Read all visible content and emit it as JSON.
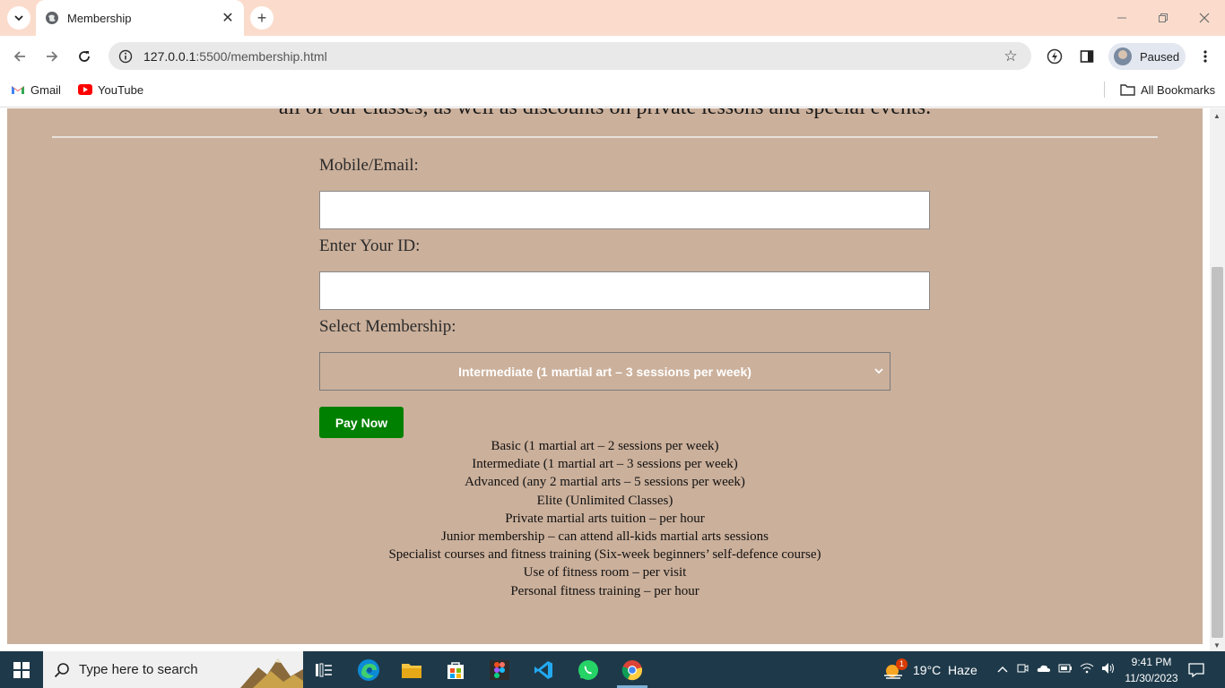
{
  "browser": {
    "tab_title": "Membership",
    "url_host": "127.0.0.1",
    "url_rest": ":5500/membership.html",
    "profile_label": "Paused",
    "bookmarks": [
      "Gmail",
      "YouTube"
    ],
    "all_bookmarks": "All Bookmarks"
  },
  "page": {
    "cut_heading": "all of our classes, as well as discounts on private lessons and special events.",
    "form": {
      "mobile_label": "Mobile/Email:",
      "mobile_value": "",
      "id_label": "Enter Your ID:",
      "id_value": "",
      "membership_label": "Select Membership:",
      "membership_selected": "Intermediate (1 martial art – 3 sessions per week)",
      "pay_button": "Pay Now"
    },
    "plans": [
      "Basic (1 martial art – 2 sessions per week)",
      "Intermediate (1 martial art – 3 sessions per week)",
      "Advanced (any 2 martial arts – 5 sessions per week)",
      "Elite (Unlimited Classes)",
      "Private martial arts tuition – per hour",
      "Junior membership – can attend all-kids martial arts sessions",
      "Specialist courses and fitness training (Six-week beginners’ self-defence course)",
      "Use of fitness room – per visit",
      "Personal fitness training – per hour"
    ]
  },
  "taskbar": {
    "search_placeholder": "Type here to search",
    "weather": "19°C  Haze",
    "weather_badge": "1",
    "time": "9:41 PM",
    "date": "11/30/2023"
  },
  "colors": {
    "page_bg": "#cbb09b",
    "pay_button": "#008000",
    "tabbar": "#fbdccc",
    "taskbar": "#1e3a4a"
  }
}
